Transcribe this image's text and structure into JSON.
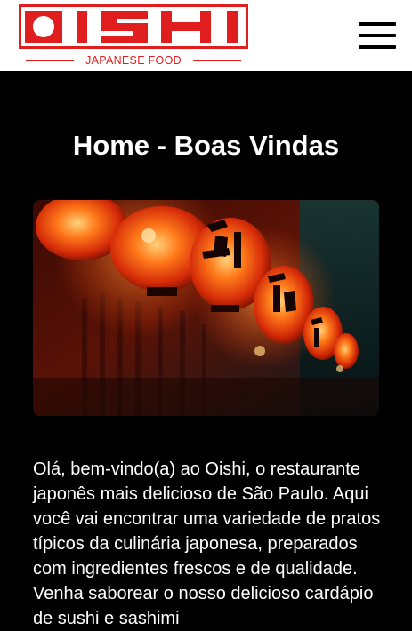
{
  "header": {
    "logo_letters": [
      "O",
      "I",
      "S",
      "H",
      "I"
    ],
    "logo_subtitle": "JAPANESE FOOD",
    "brand_color": "#e01e1e",
    "menu_icon": "hamburger-icon"
  },
  "main": {
    "title": "Home - Boas Vindas",
    "hero_image": "red-paper-lanterns-with-japanese-characters",
    "intro": "Olá, bem-vindo(a) ao Oishi, o restaurante japonês mais delicioso de São Paulo. Aqui você vai encontrar uma variedade de pratos típicos da culinária japonesa, preparados com ingredientes frescos e de qualidade. Venha saborear o nosso delicioso cardápio de sushi e sashimi"
  }
}
